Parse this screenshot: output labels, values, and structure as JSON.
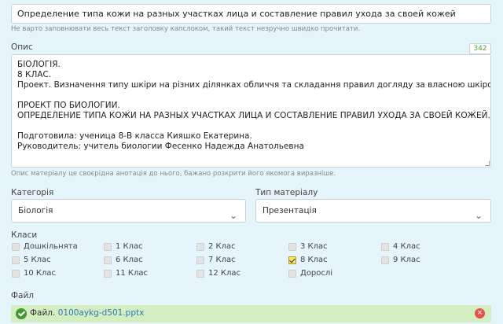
{
  "title_field": {
    "value": "Определение типа кожи на разных участках лица и составление правил ухода за своей кожей",
    "hint": "Не варто заповнювати весь текст заголовку капслоком, такий текст незручно швидко прочитати."
  },
  "description": {
    "label": "Опис",
    "counter": "342",
    "lines": [
      "БІОЛОГІЯ.",
      "8 КЛАС.",
      "Проект. Визначення типу шкіри на різних ділянках обличчя та складання правил догляду за власною шкірою.",
      "",
      "ПРОЕКТ ПО БИОЛОГИИ.",
      "ОПРЕДЕЛЕНИЕ ТИПА КОЖИ НА РАЗНЫХ УЧАСТКАХ ЛИЦА И СОСТАВЛЕНИЕ ПРАВИЛ УХОДА ЗА СВОЕЙ КОЖЕЙ.",
      "",
      "Подготовила: ученица 8-В класса  Кияшко Екатерина.",
      "Руководитель: учитель биологии Фесенко Надежда Анатольевна"
    ],
    "hint": "Опис матеріалу це своєрідна анотація до нього, бажано розкрити його якомога виразніше."
  },
  "category": {
    "label": "Категорія",
    "value": "Біологія"
  },
  "material_type": {
    "label": "Тип матеріалу",
    "value": "Презентація"
  },
  "classes": {
    "label": "Класи",
    "items": [
      {
        "label": "Дошкільнята",
        "checked": false
      },
      {
        "label": "1 Клас",
        "checked": false
      },
      {
        "label": "2 Клас",
        "checked": false
      },
      {
        "label": "3 Клас",
        "checked": false
      },
      {
        "label": "4 Клас",
        "checked": false
      },
      {
        "label": "5 Клас",
        "checked": false
      },
      {
        "label": "6 Клас",
        "checked": false
      },
      {
        "label": "7 Клас",
        "checked": false
      },
      {
        "label": "8 Клас",
        "checked": true
      },
      {
        "label": "9 Клас",
        "checked": false
      },
      {
        "label": "10 Клас",
        "checked": false
      },
      {
        "label": "11 Клас",
        "checked": false
      },
      {
        "label": "12 Клас",
        "checked": false
      },
      {
        "label": "Дорослі",
        "checked": false
      }
    ]
  },
  "file": {
    "label": "Файл",
    "prefix": "Файл.",
    "name": "0100aykg-d501.pptx",
    "delete_glyph": "×"
  }
}
